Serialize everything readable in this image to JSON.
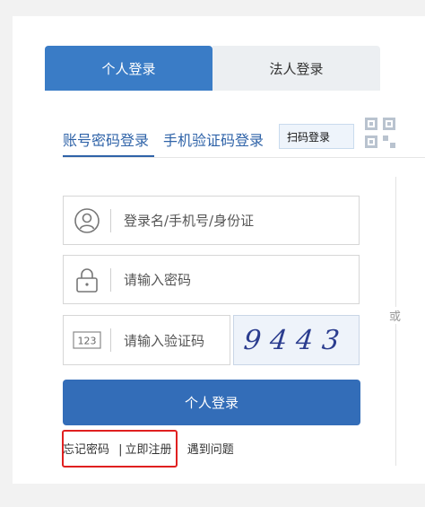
{
  "login_type_tabs": [
    {
      "label": "个人登录",
      "active": true
    },
    {
      "label": "法人登录",
      "active": false
    }
  ],
  "login_methods": {
    "account": "账号密码登录",
    "sms": "手机验证码登录",
    "scan": "扫码登录"
  },
  "form": {
    "username_placeholder": "登录名/手机号/身份证",
    "password_placeholder": "请输入密码",
    "captcha_placeholder": "请输入验证码",
    "captcha_image_text": "9443",
    "captcha_icon_text": "123"
  },
  "or_label": "或",
  "login_button": "个人登录",
  "links": {
    "forgot": "忘记密码",
    "separator": "|",
    "register": "立即注册",
    "problem": "遇到问题"
  },
  "colors": {
    "primary": "#3a7cc6",
    "button": "#336db8",
    "tab_text": "#2f63a8",
    "highlight_box": "#e02020"
  },
  "icons": [
    "user-icon",
    "lock-icon",
    "captcha-123-icon",
    "qr-code-icon"
  ]
}
